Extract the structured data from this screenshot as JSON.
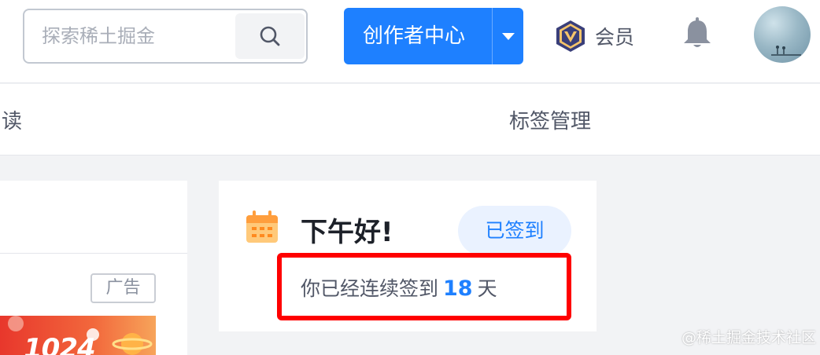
{
  "header": {
    "search": {
      "placeholder": "探索稀土掘金",
      "value": ""
    },
    "creator_center_label": "创作者中心",
    "vip_label": "会员",
    "colors": {
      "primary": "#1e80ff",
      "vip_badge": "#3a3f7a",
      "vip_gold": "#f5c46a"
    }
  },
  "subnav": {
    "read_label": "读",
    "tag_manage_label": "标签管理"
  },
  "feed": {
    "ad_label": "广告",
    "banner_text": "1024"
  },
  "signin": {
    "greeting": "下午好!",
    "signed_label": "已签到",
    "streak_prefix": "你已经连续签到",
    "streak_days": "18",
    "streak_suffix": "天",
    "highlight_color": "#ff0000"
  },
  "watermark": "@稀土掘金技术社区",
  "icons": [
    "search-icon",
    "chevron-down-icon",
    "vip-badge-icon",
    "bell-icon",
    "calendar-icon"
  ]
}
